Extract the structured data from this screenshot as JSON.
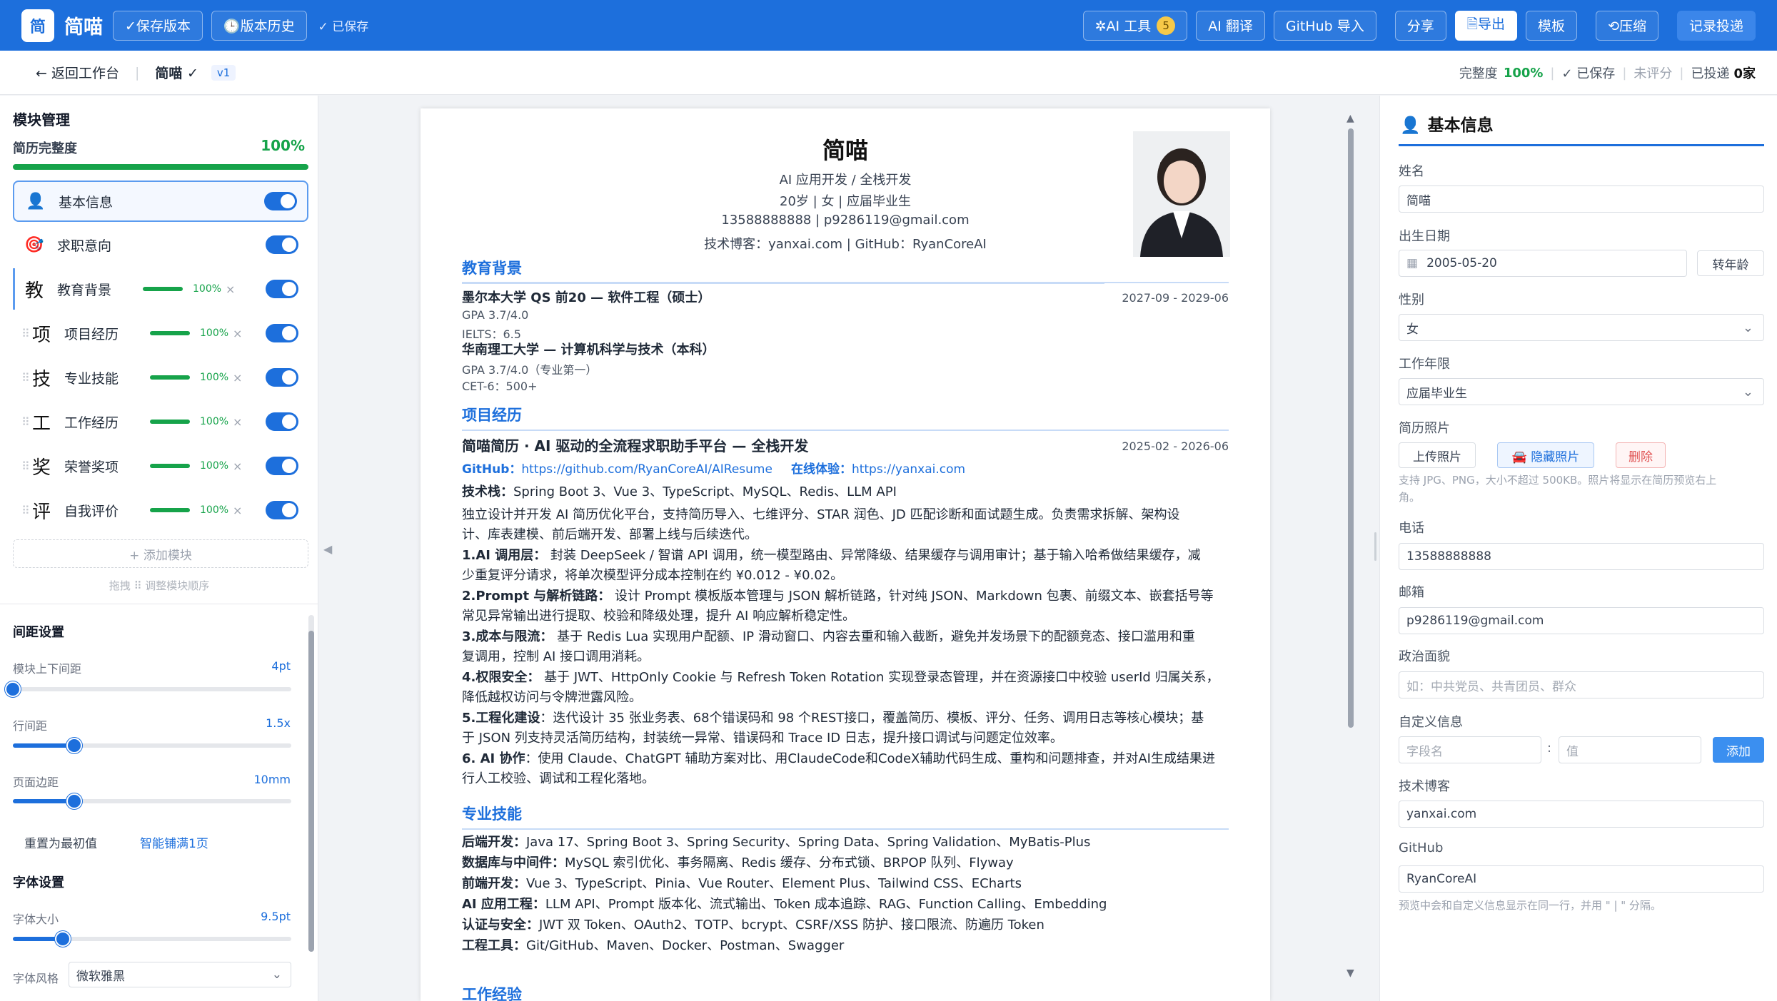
{
  "topbar": {
    "logo": "简",
    "app_name": "简喵",
    "save_version": "✓保存版本",
    "version_history": "🕒版本历史",
    "saved": "✓ 已保存",
    "ai_tools": "✲AI 工具",
    "ai_badge": "5",
    "ai_translate": "AI 翻译",
    "github_import": "GitHub 导入",
    "share": "分享",
    "export": "🗎导出",
    "template": "模板",
    "compress": "⟲压缩",
    "record": "记录投递"
  },
  "subbar": {
    "back": "← 返回工作台",
    "name": "简喵 ✓",
    "version": "v1",
    "completeness_label": "完整度",
    "completeness": "100%",
    "saved": "✓ 已保存",
    "score": "未评分",
    "applied_label": "已投递",
    "applied": "0家"
  },
  "left": {
    "title": "模块管理",
    "completeness_label": "简历完整度",
    "completeness": "100%",
    "completeness_value": 1.0,
    "modules": [
      {
        "icon": "👤",
        "label": "基本信息",
        "active": true
      },
      {
        "icon": "🎯",
        "label": "求职意向"
      },
      {
        "icon": "教",
        "label": "教育背景",
        "pct": "100%"
      },
      {
        "icon": "项",
        "label": "项目经历",
        "pct": "100%"
      },
      {
        "icon": "技",
        "label": "专业技能",
        "pct": "100%"
      },
      {
        "icon": "工",
        "label": "工作经历",
        "pct": "100%"
      },
      {
        "icon": "奖",
        "label": "荣誉奖项",
        "pct": "100%"
      },
      {
        "icon": "评",
        "label": "自我评价",
        "pct": "100%"
      }
    ],
    "add_module": "+ 添加模块",
    "drag_hint": "拖拽 ⠿ 调整模块顺序",
    "spacing_title": "间距设置",
    "sliders": [
      {
        "label": "模块上下间距",
        "value": "4pt",
        "level": 0.0
      },
      {
        "label": "行间距",
        "value": "1.5x",
        "level": 0.22
      },
      {
        "label": "页面边距",
        "value": "10mm",
        "level": 0.22
      }
    ],
    "reset": "重置为最初值",
    "smart": "智能铺满1页",
    "font_title": "字体设置",
    "font_size": {
      "label": "字体大小",
      "value": "9.5pt",
      "level": 0.18
    },
    "font_style_label": "字体风格",
    "font_style": "微软雅黑"
  },
  "resume": {
    "name": "简喵",
    "role": "AI 应用开发 / 全栈开发",
    "meta": "20岁 | 女 | 应届毕业生",
    "contact": "13588888888 | p9286119@gmail.com",
    "links": "技术博客：yanxai.com | GitHub：RyanCoreAI",
    "edu_title": "教育背景",
    "edu": [
      {
        "school": "墨尔本大学 QS 前20 — 软件工程（硕士）",
        "date": "2027-09 - 2029-06",
        "l1": "GPA 3.7/4.0",
        "l2": "IELTS：6.5"
      },
      {
        "school": "华南理工大学 — 计算机科学与技术（本科）",
        "l1": "GPA 3.7/4.0（专业第一）",
        "l2": "CET-6：500+"
      }
    ],
    "proj_title": "项目经历",
    "proj": {
      "name": "简喵简历 · AI 驱动的全流程求职助手平台 — 全栈开发",
      "date": "2025-02 - 2026-06",
      "gh_label": "GitHub：",
      "gh": "https://github.com/RyanCoreAI/AIResume",
      "demo_label": "在线体验：",
      "demo": "https://yanxai.com",
      "stack_label": "技术栈：",
      "stack": "Spring Boot 3、Vue 3、TypeScript、MySQL、Redis、LLM API",
      "desc1": "独立设计并开发 AI 简历优化平台，支持简历导入、七维评分、STAR 润色、JD 匹配诊断和面试题生成。负责需求拆解、架构设",
      "desc2": "计、库表建模、前后端开发、部署上线与后续迭代。",
      "p1a": "1.AI 调用层：",
      "p1b": "封装 DeepSeek / 智谱 API 调用，统一模型路由、异常降级、结果缓存与调用审计；基于输入哈希做结果缓存，减",
      "p1c": "少重复评分请求，将单次模型评分成本控制在约 ¥0.012 - ¥0.02。",
      "p2a": "2.Prompt 与解析链路：",
      "p2b": "设计 Prompt 模板版本管理与 JSON 解析链路，针对纯 JSON、Markdown 包裹、前缀文本、嵌套括号等",
      "p2c": "常见异常输出进行提取、校验和降级处理，提升 AI 响应解析稳定性。",
      "p3a": "3.成本与限流：",
      "p3b": "基于 Redis Lua 实现用户配额、IP 滑动窗口、内容去重和输入截断，避免并发场景下的配额竞态、接口滥用和重",
      "p3c": "复调用，控制 AI 接口调用消耗。",
      "p4a": "4.权限安全：",
      "p4b": "基于 JWT、HttpOnly Cookie 与 Refresh Token Rotation 实现登录态管理，并在资源接口中校验 userId 归属关系，",
      "p4c": "降低越权访问与令牌泄露风险。",
      "p5a": "5.工程化建设",
      "p5b": "：迭代设计 35 张业务表、68个错误码和 98 个REST接口，覆盖简历、模板、评分、任务、调用日志等核心模块；基",
      "p5c": "于 JSON 列支持灵活简历结构，封装统一异常、错误码和 Trace ID 日志，提升接口调试与问题定位效率。",
      "p6a": "6. AI 协作",
      "p6b": "：使用 Claude、ChatGPT 辅助方案对比、用ClaudeCode和CodeX辅助代码生成、重构和问题排查，并对AI生成结果进",
      "p6c": "行人工校验、调试和工程化落地。"
    },
    "skill_title": "专业技能",
    "skills": [
      {
        "k": "后端开发：",
        "v": "Java 17、Spring Boot 3、Spring Security、Spring Data、Spring Validation、MyBatis-Plus"
      },
      {
        "k": "数据库与中间件：",
        "v": "MySQL 索引优化、事务隔离、Redis 缓存、分布式锁、BRPOP 队列、Flyway"
      },
      {
        "k": "前端开发：",
        "v": "Vue 3、TypeScript、Pinia、Vue Router、Element Plus、Tailwind CSS、ECharts"
      },
      {
        "k": "AI 应用工程：",
        "v": "LLM API、Prompt 版本化、流式输出、Token 成本追踪、RAG、Function Calling、Embedding"
      },
      {
        "k": "认证与安全：",
        "v": "JWT 双 Token、OAuth2、TOTP、bcrypt、CSRF/XSS 防护、接口限流、防遍历 Token"
      },
      {
        "k": "工程工具：",
        "v": "Git/GitHub、Maven、Docker、Postman、Swagger"
      }
    ],
    "work_title": "工作经验"
  },
  "right": {
    "title": "基本信息",
    "name_label": "姓名",
    "name": "简喵",
    "dob_label": "出生日期",
    "dob": "2005-05-20",
    "to_age": "转年龄",
    "gender_label": "性别",
    "gender": "女",
    "years_label": "工作年限",
    "years": "应届毕业生",
    "photo_label": "简历照片",
    "upload": "上传照片",
    "hide": "🚘 隐藏照片",
    "delete": "删除",
    "photo_hint1": "支持 JPG、PNG，大小不超过 500KB。照片将显示在简历预览右上",
    "photo_hint2": "角。",
    "phone_label": "电话",
    "phone": "13588888888",
    "email_label": "邮箱",
    "email": "p9286119@gmail.com",
    "politics_label": "政治面貌",
    "politics_ph": "如：中共党员、共青团员、群众",
    "custom_label": "自定义信息",
    "field_ph": "字段名",
    "value_ph": "值",
    "add": "添加",
    "blog_label": "技术博客",
    "blog": "yanxai.com",
    "gh_label": "GitHub",
    "gh": "RyanCoreAI",
    "hint": "预览中会和自定义信息显示在同一行，并用 \" | \" 分隔。"
  },
  "colors": {
    "primary": "#1d6fdc",
    "success": "#16a34a"
  }
}
